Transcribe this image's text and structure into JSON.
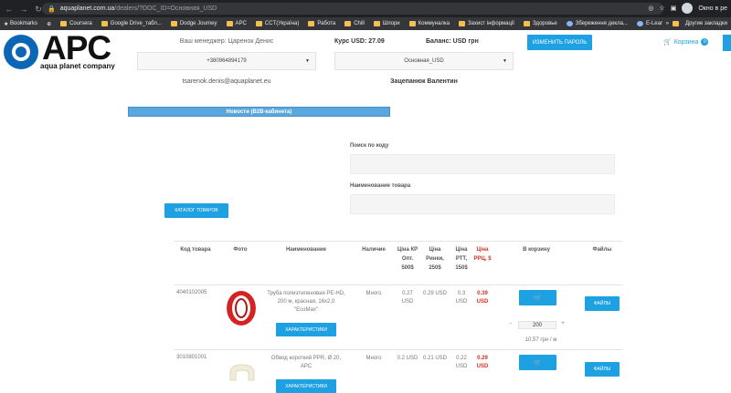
{
  "browser": {
    "url_host": "aquaplanet.com.ua",
    "url_rest": "/dealers/?DOC_ID=Основная_USD",
    "profile": "Окно в ре",
    "bookmarks_label": "Bookmarks",
    "bookmarks": [
      "Coursera",
      "Google Drive_табл...",
      "Dodge Journey",
      "APC",
      "CCT(Україна)",
      "Работа",
      "Chill",
      "Шпори",
      "Коммуналка",
      "Захист інформації",
      "Здоровье",
      "Збереження декла...",
      "E-Learning Server o..."
    ],
    "other_bookmarks": "Другие закладки"
  },
  "header": {
    "logo_text": "APC",
    "logo_sub": "aqua planet company",
    "manager": "Ваш менеджер: Царенок Денис",
    "phone": "+380964894179",
    "email": "tsarenok.denis@aquaplanet.eu",
    "kurs": "Курс USD: 27.09",
    "balance": "Баланс: USD грн",
    "doc_select": "Основная_USD",
    "person": "Зацепанюк Валентин",
    "change_password": "ИЗМЕНИТЬ ПАРОЛЬ",
    "cart_label": "Корзина",
    "cart_count": "0"
  },
  "news": {
    "title": "Новости (B2B-кабинета)"
  },
  "search": {
    "by_code_label": "Поиск по коду",
    "by_code_value": "",
    "by_name_label": "Наименование товара",
    "by_name_value": "",
    "catalog_button": "КАТАЛОГ ТОВАРОВ"
  },
  "table": {
    "headers": {
      "code": "Код товара",
      "photo": "Фото",
      "name": "Наименование",
      "stock": "Наличие",
      "price1": "Ціна КР Опт. 500$",
      "price2": "Ціна Ринки, 250$",
      "price3": "Ціна РТТ, 150$",
      "price_rrc": "Ціна РРЦ, $",
      "cart": "В корзину",
      "files": "Файлы"
    },
    "rows": [
      {
        "code": "4040102005",
        "name": "Труба полиэтиленовая PE-HD, 200 м, красная, 16x2,0 \"EcoMax\"",
        "stock": "Много",
        "price1": "0.27 USD",
        "price2": "0.29 USD",
        "price3": "0.3 USD",
        "price_rrc": "0.39 USD",
        "qty": "200",
        "minus": "-",
        "plus": "+",
        "unit_price": "10.57 грн / м",
        "features_button": "ХАРАКТЕРИСТИКИ",
        "files_button": "ФАЙЛЫ"
      },
      {
        "code": "3010801001",
        "name": "Обвод короткий PPR, Ø 20, APC",
        "stock": "Много",
        "price1": "0.2 USD",
        "price2": "0.21 USD",
        "price3": "0.22 USD",
        "price_rrc": "0.29 USD",
        "features_button": "ХАРАКТЕРИСТИКИ",
        "files_button": "ФАЙЛЫ"
      }
    ]
  },
  "colors": {
    "accent": "#1da1e2",
    "news_bar": "#5aa7de",
    "price_red": "#d93025"
  }
}
